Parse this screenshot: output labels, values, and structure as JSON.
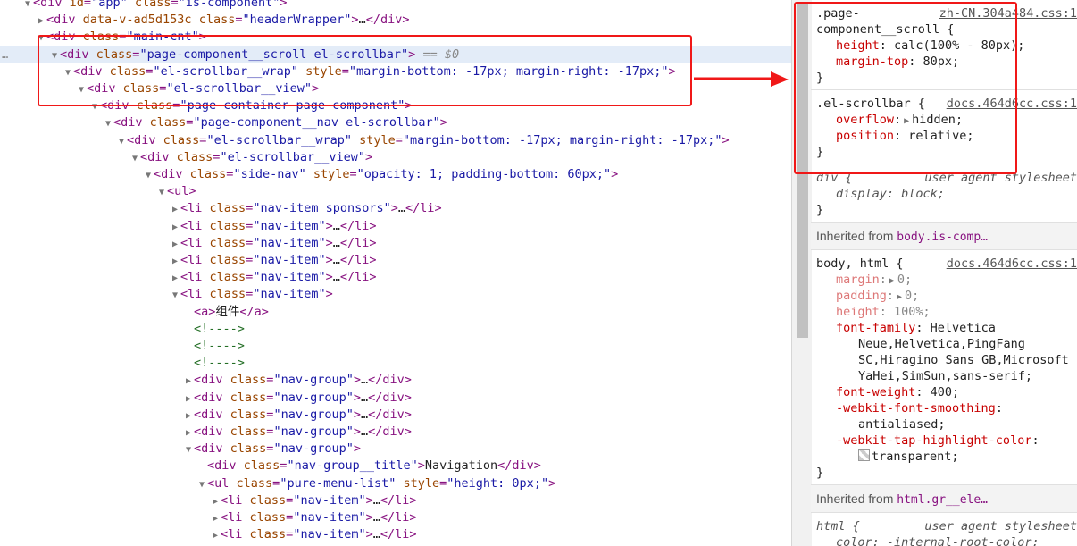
{
  "dom_rows": [
    {
      "depth": 1,
      "toggle": "open",
      "tokens": [
        [
          "tag",
          "<"
        ],
        [
          "tag",
          "div"
        ],
        [
          "at",
          " id"
        ],
        [
          "tag",
          "="
        ],
        [
          "av",
          "\"app\""
        ],
        [
          "at",
          " class"
        ],
        [
          "tag",
          "="
        ],
        [
          "av",
          "\"is-component\""
        ],
        [
          "tag",
          ">"
        ]
      ]
    },
    {
      "depth": 2,
      "toggle": "closed",
      "tokens": [
        [
          "tag",
          "<div"
        ],
        [
          "at",
          " data-v-ad5d153c"
        ],
        [
          "at",
          " class"
        ],
        [
          "tag",
          "="
        ],
        [
          "av",
          "\"headerWrapper\""
        ],
        [
          "tag",
          ">"
        ],
        [
          "tx",
          "…"
        ],
        [
          "tag",
          "</div>"
        ]
      ]
    },
    {
      "depth": 2,
      "toggle": "open",
      "tokens": [
        [
          "tag",
          "<div"
        ],
        [
          "at",
          " class"
        ],
        [
          "tag",
          "="
        ],
        [
          "av",
          "\"main-cnt\""
        ],
        [
          "tag",
          ">"
        ]
      ]
    },
    {
      "depth": 3,
      "toggle": "open",
      "selected": true,
      "tokens": [
        [
          "tag",
          "<div"
        ],
        [
          "at",
          " class"
        ],
        [
          "tag",
          "="
        ],
        [
          "av",
          "\"page-component__scroll el-scrollbar\""
        ],
        [
          "tag",
          ">"
        ],
        [
          "dollar",
          " == $0"
        ]
      ]
    },
    {
      "depth": 4,
      "toggle": "open",
      "tokens": [
        [
          "tag",
          "<div"
        ],
        [
          "at",
          " class"
        ],
        [
          "tag",
          "="
        ],
        [
          "av",
          "\"el-scrollbar__wrap\""
        ],
        [
          "at",
          " style"
        ],
        [
          "tag",
          "="
        ],
        [
          "av",
          "\"margin-bottom: -17px; margin-right: -17px;\""
        ],
        [
          "tag",
          ">"
        ]
      ]
    },
    {
      "depth": 5,
      "toggle": "open",
      "tokens": [
        [
          "tag",
          "<div"
        ],
        [
          "at",
          " class"
        ],
        [
          "tag",
          "="
        ],
        [
          "av",
          "\"el-scrollbar__view\""
        ],
        [
          "tag",
          ">"
        ]
      ]
    },
    {
      "depth": 6,
      "toggle": "open",
      "tokens": [
        [
          "tag",
          "<div"
        ],
        [
          "at",
          " class"
        ],
        [
          "tag",
          "="
        ],
        [
          "av",
          "\"page-container page-component\""
        ],
        [
          "tag",
          ">"
        ]
      ]
    },
    {
      "depth": 7,
      "toggle": "open",
      "tokens": [
        [
          "tag",
          "<div"
        ],
        [
          "at",
          " class"
        ],
        [
          "tag",
          "="
        ],
        [
          "av",
          "\"page-component__nav el-scrollbar\""
        ],
        [
          "tag",
          ">"
        ]
      ]
    },
    {
      "depth": 8,
      "toggle": "open",
      "tokens": [
        [
          "tag",
          "<div"
        ],
        [
          "at",
          " class"
        ],
        [
          "tag",
          "="
        ],
        [
          "av",
          "\"el-scrollbar__wrap\""
        ],
        [
          "at",
          " style"
        ],
        [
          "tag",
          "="
        ],
        [
          "av",
          "\"margin-bottom: -17px; margin-right: -17px;\""
        ],
        [
          "tag",
          ">"
        ]
      ]
    },
    {
      "depth": 9,
      "toggle": "open",
      "tokens": [
        [
          "tag",
          "<div"
        ],
        [
          "at",
          " class"
        ],
        [
          "tag",
          "="
        ],
        [
          "av",
          "\"el-scrollbar__view\""
        ],
        [
          "tag",
          ">"
        ]
      ]
    },
    {
      "depth": 10,
      "toggle": "open",
      "tokens": [
        [
          "tag",
          "<div"
        ],
        [
          "at",
          " class"
        ],
        [
          "tag",
          "="
        ],
        [
          "av",
          "\"side-nav\""
        ],
        [
          "at",
          " style"
        ],
        [
          "tag",
          "="
        ],
        [
          "av",
          "\"opacity: 1; padding-bottom: 60px;\""
        ],
        [
          "tag",
          ">"
        ]
      ]
    },
    {
      "depth": 11,
      "toggle": "open",
      "tokens": [
        [
          "tag",
          "<ul>"
        ]
      ]
    },
    {
      "depth": 12,
      "toggle": "closed",
      "tokens": [
        [
          "tag",
          "<li"
        ],
        [
          "at",
          " class"
        ],
        [
          "tag",
          "="
        ],
        [
          "av",
          "\"nav-item sponsors\""
        ],
        [
          "tag",
          ">"
        ],
        [
          "tx",
          "…"
        ],
        [
          "tag",
          "</li>"
        ]
      ]
    },
    {
      "depth": 12,
      "toggle": "closed",
      "tokens": [
        [
          "tag",
          "<li"
        ],
        [
          "at",
          " class"
        ],
        [
          "tag",
          "="
        ],
        [
          "av",
          "\"nav-item\""
        ],
        [
          "tag",
          ">"
        ],
        [
          "tx",
          "…"
        ],
        [
          "tag",
          "</li>"
        ]
      ]
    },
    {
      "depth": 12,
      "toggle": "closed",
      "tokens": [
        [
          "tag",
          "<li"
        ],
        [
          "at",
          " class"
        ],
        [
          "tag",
          "="
        ],
        [
          "av",
          "\"nav-item\""
        ],
        [
          "tag",
          ">"
        ],
        [
          "tx",
          "…"
        ],
        [
          "tag",
          "</li>"
        ]
      ]
    },
    {
      "depth": 12,
      "toggle": "closed",
      "tokens": [
        [
          "tag",
          "<li"
        ],
        [
          "at",
          " class"
        ],
        [
          "tag",
          "="
        ],
        [
          "av",
          "\"nav-item\""
        ],
        [
          "tag",
          ">"
        ],
        [
          "tx",
          "…"
        ],
        [
          "tag",
          "</li>"
        ]
      ]
    },
    {
      "depth": 12,
      "toggle": "closed",
      "tokens": [
        [
          "tag",
          "<li"
        ],
        [
          "at",
          " class"
        ],
        [
          "tag",
          "="
        ],
        [
          "av",
          "\"nav-item\""
        ],
        [
          "tag",
          ">"
        ],
        [
          "tx",
          "…"
        ],
        [
          "tag",
          "</li>"
        ]
      ]
    },
    {
      "depth": 12,
      "toggle": "open",
      "tokens": [
        [
          "tag",
          "<li"
        ],
        [
          "at",
          " class"
        ],
        [
          "tag",
          "="
        ],
        [
          "av",
          "\"nav-item\""
        ],
        [
          "tag",
          ">"
        ]
      ]
    },
    {
      "depth": 13,
      "toggle": "none",
      "tokens": [
        [
          "tag",
          "<a>"
        ],
        [
          "tx",
          "组件"
        ],
        [
          "tag",
          "</a>"
        ]
      ]
    },
    {
      "depth": 13,
      "toggle": "none",
      "tokens": [
        [
          "cm",
          "<!---->"
        ]
      ]
    },
    {
      "depth": 13,
      "toggle": "none",
      "tokens": [
        [
          "cm",
          "<!---->"
        ]
      ]
    },
    {
      "depth": 13,
      "toggle": "none",
      "tokens": [
        [
          "cm",
          "<!---->"
        ]
      ]
    },
    {
      "depth": 13,
      "toggle": "closed",
      "tokens": [
        [
          "tag",
          "<div"
        ],
        [
          "at",
          " class"
        ],
        [
          "tag",
          "="
        ],
        [
          "av",
          "\"nav-group\""
        ],
        [
          "tag",
          ">"
        ],
        [
          "tx",
          "…"
        ],
        [
          "tag",
          "</div>"
        ]
      ]
    },
    {
      "depth": 13,
      "toggle": "closed",
      "tokens": [
        [
          "tag",
          "<div"
        ],
        [
          "at",
          " class"
        ],
        [
          "tag",
          "="
        ],
        [
          "av",
          "\"nav-group\""
        ],
        [
          "tag",
          ">"
        ],
        [
          "tx",
          "…"
        ],
        [
          "tag",
          "</div>"
        ]
      ]
    },
    {
      "depth": 13,
      "toggle": "closed",
      "tokens": [
        [
          "tag",
          "<div"
        ],
        [
          "at",
          " class"
        ],
        [
          "tag",
          "="
        ],
        [
          "av",
          "\"nav-group\""
        ],
        [
          "tag",
          ">"
        ],
        [
          "tx",
          "…"
        ],
        [
          "tag",
          "</div>"
        ]
      ]
    },
    {
      "depth": 13,
      "toggle": "closed",
      "tokens": [
        [
          "tag",
          "<div"
        ],
        [
          "at",
          " class"
        ],
        [
          "tag",
          "="
        ],
        [
          "av",
          "\"nav-group\""
        ],
        [
          "tag",
          ">"
        ],
        [
          "tx",
          "…"
        ],
        [
          "tag",
          "</div>"
        ]
      ]
    },
    {
      "depth": 13,
      "toggle": "open",
      "tokens": [
        [
          "tag",
          "<div"
        ],
        [
          "at",
          " class"
        ],
        [
          "tag",
          "="
        ],
        [
          "av",
          "\"nav-group\""
        ],
        [
          "tag",
          ">"
        ]
      ]
    },
    {
      "depth": 14,
      "toggle": "none",
      "tokens": [
        [
          "tag",
          "<div"
        ],
        [
          "at",
          " class"
        ],
        [
          "tag",
          "="
        ],
        [
          "av",
          "\"nav-group__title\""
        ],
        [
          "tag",
          ">"
        ],
        [
          "tx",
          "Navigation"
        ],
        [
          "tag",
          "</div>"
        ]
      ]
    },
    {
      "depth": 14,
      "toggle": "open",
      "tokens": [
        [
          "tag",
          "<ul"
        ],
        [
          "at",
          " class"
        ],
        [
          "tag",
          "="
        ],
        [
          "av",
          "\"pure-menu-list\""
        ],
        [
          "at",
          " style"
        ],
        [
          "tag",
          "="
        ],
        [
          "av",
          "\"height: 0px;\""
        ],
        [
          "tag",
          ">"
        ]
      ]
    },
    {
      "depth": 15,
      "toggle": "closed",
      "tokens": [
        [
          "tag",
          "<li"
        ],
        [
          "at",
          " class"
        ],
        [
          "tag",
          "="
        ],
        [
          "av",
          "\"nav-item\""
        ],
        [
          "tag",
          ">"
        ],
        [
          "tx",
          "…"
        ],
        [
          "tag",
          "</li>"
        ]
      ]
    },
    {
      "depth": 15,
      "toggle": "closed",
      "tokens": [
        [
          "tag",
          "<li"
        ],
        [
          "at",
          " class"
        ],
        [
          "tag",
          "="
        ],
        [
          "av",
          "\"nav-item\""
        ],
        [
          "tag",
          ">"
        ],
        [
          "tx",
          "…"
        ],
        [
          "tag",
          "</li>"
        ]
      ]
    },
    {
      "depth": 15,
      "toggle": "closed",
      "tokens": [
        [
          "tag",
          "<li"
        ],
        [
          "at",
          " class"
        ],
        [
          "tag",
          "="
        ],
        [
          "av",
          "\"nav-item\""
        ],
        [
          "tag",
          ">"
        ],
        [
          "tx",
          "…"
        ],
        [
          "tag",
          "</li>"
        ]
      ]
    }
  ],
  "selected_marker": "…",
  "styles": {
    "rule1": {
      "selector": ".page-component__scroll {",
      "selector_line1": ".page-",
      "selector_line2": "component__scroll {",
      "source": "zh-CN.304a484.css:1",
      "decls": [
        {
          "name": "height",
          "value": "calc(100% - 80px);"
        },
        {
          "name": "margin-top",
          "value": "80px;"
        }
      ],
      "close": "}"
    },
    "rule2": {
      "selector": ".el-scrollbar {",
      "source": "docs.464d6cc.css:1",
      "decls": [
        {
          "name": "overflow",
          "value": "hidden;"
        },
        {
          "name": "position",
          "value": "relative;"
        }
      ],
      "close": "}"
    },
    "rule3": {
      "selector": "div {",
      "source": "user agent stylesheet",
      "decls": [
        {
          "name": "display",
          "value": "block;"
        }
      ],
      "close": "}"
    },
    "inherit1": {
      "label": "Inherited from ",
      "link": "body.is-comp…"
    },
    "rule4": {
      "selector": "body, html {",
      "source": "docs.464d6cc.css:1",
      "dim_decls": [
        {
          "name": "margin",
          "value": "0;"
        },
        {
          "name": "padding",
          "value": "0;"
        },
        {
          "name": "height",
          "value": "100%;"
        }
      ],
      "font_family_name": "font-family",
      "font_family_lines": [
        "Helvetica",
        "Neue,Helvetica,PingFang",
        "SC,Hiragino Sans GB,Microsoft",
        "YaHei,SimSun,sans-serif;"
      ],
      "font_weight": {
        "name": "font-weight",
        "value": "400;"
      },
      "smoothing": {
        "name": "-webkit-font-smoothing",
        "value": "antialiased;"
      },
      "tap": {
        "name": "-webkit-tap-highlight-color",
        "value": "transparent;"
      },
      "close": "}"
    },
    "inherit2": {
      "label": "Inherited from ",
      "link": "html.gr__ele…"
    },
    "rule5": {
      "selector": "html {",
      "source": "user agent stylesheet",
      "partial": "color: -internal-root-color;"
    }
  },
  "colors": {
    "highlight": "#f01818",
    "selected_row": "#e3ecf8"
  }
}
